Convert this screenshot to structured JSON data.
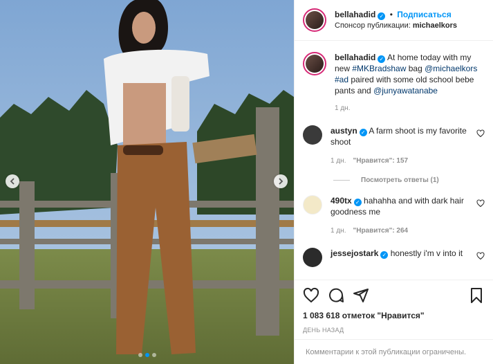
{
  "header": {
    "username": "bellahadid",
    "separator": "•",
    "follow_label": "Подписаться",
    "sponsor_prefix": "Спонсор публикации:",
    "sponsor_name": "michaelkors",
    "verified_mark": "✓"
  },
  "caption": {
    "username": "bellahadid",
    "text_1": "At home today with my new",
    "hashtag_1": "#MKBradshaw",
    "text_2": "bag",
    "mention_1": "@michaelkors",
    "hashtag_2": "#ad",
    "text_3": "paired with some old school bebe pants and",
    "mention_2": "@junyawatanabe",
    "time": "1 дн."
  },
  "comments": [
    {
      "username": "austyn",
      "verified": true,
      "text": "A farm shoot is my favorite shoot",
      "time": "1 дн.",
      "likes": "\"Нравится\": 157",
      "avatar_color": "#3a3a3a"
    },
    {
      "username": "490tx",
      "verified": true,
      "text": "hahahha and with dark hair goodness me",
      "time": "1 дн.",
      "likes": "\"Нравится\": 264",
      "avatar_color": "#f3e9c8"
    },
    {
      "username": "jessejostark",
      "verified": true,
      "text": "honestly i'm v into it",
      "time": "",
      "likes": "",
      "avatar_color": "#2b2b2b"
    }
  ],
  "view_replies": "Посмотреть ответы (1)",
  "actions": {
    "icons": [
      "heart-icon",
      "comment-icon",
      "share-icon",
      "bookmark-icon"
    ],
    "likes_count": "1 083 618 отметок \"Нравится\"",
    "date": "ДЕНЬ НАЗАД"
  },
  "comments_closed": "Комментарии к этой публикации ограничены.",
  "colors": {
    "accent": "#0095f6",
    "text": "#262626",
    "muted": "#8e8e8e",
    "link": "#00376b"
  }
}
